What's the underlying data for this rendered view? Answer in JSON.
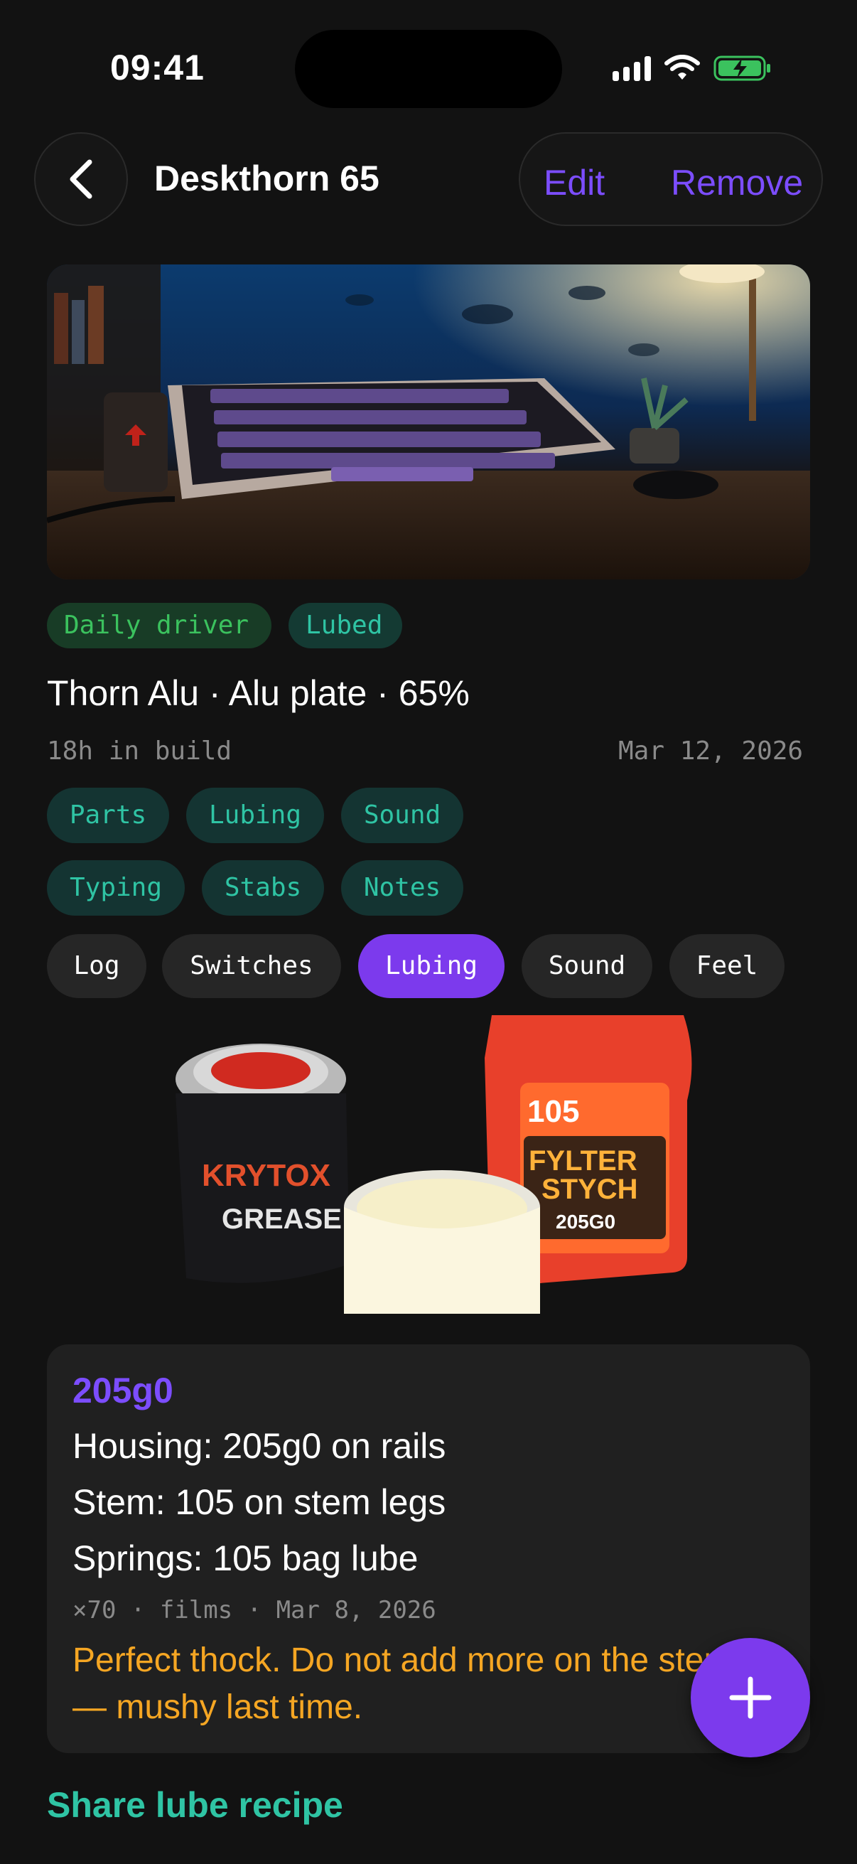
{
  "status_bar": {
    "time": "09:41"
  },
  "header": {
    "title": "Deskthorn 65",
    "edit_label": "Edit",
    "remove_label": "Remove"
  },
  "tags": [
    "Daily driver",
    "Lubed"
  ],
  "build": {
    "spec": "Thorn Alu · Alu plate · 65%",
    "hours": "18h in build",
    "date": "Mar 12, 2026"
  },
  "sections": [
    "Parts",
    "Lubing",
    "Sound",
    "Typing",
    "Stabs",
    "Notes"
  ],
  "tabs": {
    "items": [
      "Log",
      "Switches",
      "Lubing",
      "Sound",
      "Feel"
    ],
    "active": "Lubing"
  },
  "products": {
    "jar_brand": "KRYTOX",
    "jar_label": "GREASE",
    "bottle_number": "105",
    "bottle_brand_1": "FYLTER",
    "bottle_brand_2": "STYCH",
    "bottle_grade": "205G0"
  },
  "recipe": {
    "title": "205g0",
    "lines": [
      "Housing: 205g0 on rails",
      "Stem: 105 on stem legs",
      "Springs: 105 bag lube"
    ],
    "meta": "×70 · films · Mar 8, 2026",
    "note": "Perfect thock. Do not add more on the stem — mushy last time."
  },
  "share_label": "Share lube recipe",
  "colors": {
    "accent": "#7c3aed",
    "teal": "#2fc4a4",
    "green": "#3bc25e",
    "note": "#f5a623",
    "background": "#121212"
  }
}
